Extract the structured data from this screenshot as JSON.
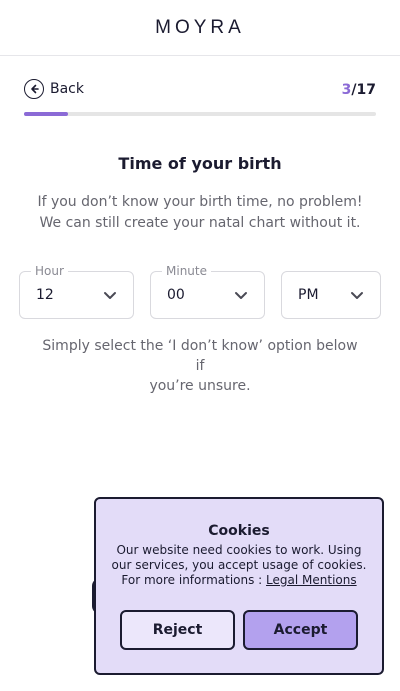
{
  "header": {
    "logo": "MOYRA"
  },
  "nav": {
    "back_label": "Back",
    "step_current": "3",
    "step_total": "/17",
    "progress_fraction": 0.125
  },
  "main": {
    "title": "Time of your birth",
    "subtitle_line1": "If you don’t know your birth time, no problem!",
    "subtitle_line2": "We can still create your natal chart without it.",
    "hint_line1": "Simply select the ‘I don’t know’ option below if",
    "hint_line2": "you’re unsure."
  },
  "fields": {
    "hour": {
      "label": "Hour",
      "value": "12"
    },
    "minute": {
      "label": "Minute",
      "value": "00"
    },
    "period": {
      "value": "PM"
    }
  },
  "cookie": {
    "title": "Cookies",
    "line1": "Our website need cookies to work. Using",
    "line2": "our services, you accept usage of cookies.",
    "line3_prefix": "For more informations : ",
    "link": "Legal Mentions",
    "reject": "Reject",
    "accept": "Accept"
  },
  "colors": {
    "accent": "#8b6ad6",
    "cookie_bg": "#e3dcf8",
    "accept_bg": "#b3a1ee"
  }
}
